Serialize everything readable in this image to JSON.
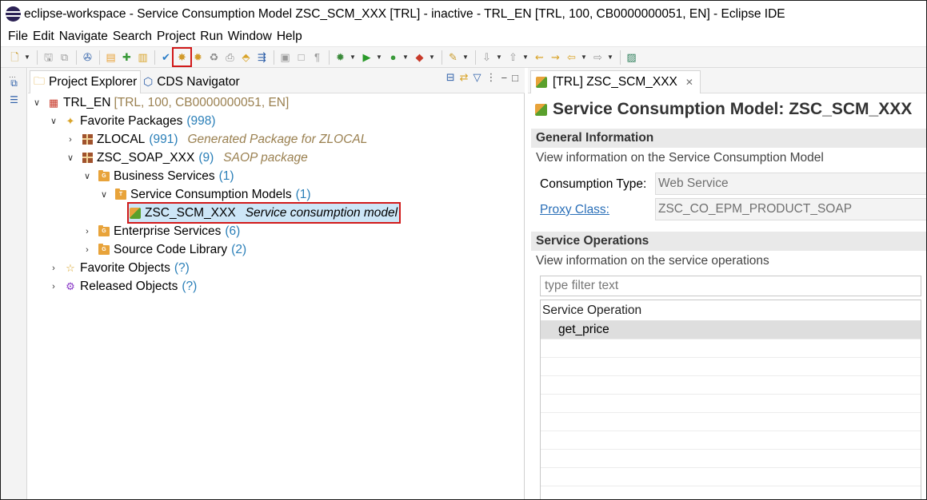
{
  "window": {
    "title": "eclipse-workspace - Service Consumption Model ZSC_SCM_XXX [TRL]  - inactive - TRL_EN [TRL, 100, CB0000000051, EN] - Eclipse IDE"
  },
  "menu": [
    "File",
    "Edit",
    "Navigate",
    "Search",
    "Project",
    "Run",
    "Window",
    "Help"
  ],
  "explorer": {
    "tabs": [
      {
        "label": "Project Explorer",
        "icon": "project-explorer-icon"
      },
      {
        "label": "CDS Navigator",
        "icon": "cds-navigator-icon"
      }
    ],
    "tree": {
      "project": {
        "label": "TRL_EN",
        "detail": "[TRL, 100, CB0000000051, EN]"
      },
      "favorite_packages": {
        "label": "Favorite Packages",
        "count": "(998)"
      },
      "zlocal": {
        "label": "ZLOCAL",
        "count": "(991)",
        "desc": "Generated Package for ZLOCAL"
      },
      "zsc_soap": {
        "label": "ZSC_SOAP_XXX",
        "count": "(9)",
        "desc": "SAOP package"
      },
      "business_services": {
        "label": "Business Services",
        "count": "(1)"
      },
      "scm_folder": {
        "label": "Service Consumption Models",
        "count": "(1)"
      },
      "scm_item": {
        "label": "ZSC_SCM_XXX",
        "desc": "Service consumption model"
      },
      "enterprise_services": {
        "label": "Enterprise Services",
        "count": "(6)"
      },
      "source_code_library": {
        "label": "Source Code Library",
        "count": "(2)"
      },
      "favorite_objects": {
        "label": "Favorite Objects",
        "count": "(?)"
      },
      "released_objects": {
        "label": "Released Objects",
        "count": "(?)"
      }
    }
  },
  "editor": {
    "tab_label": "[TRL] ZSC_SCM_XXX",
    "title": "Service Consumption Model: ZSC_SCM_XXX",
    "general": {
      "heading": "General Information",
      "description": "View information on the Service Consumption Model",
      "consumption_type_label": "Consumption Type:",
      "consumption_type_value": "Web Service",
      "proxy_class_label": "Proxy Class:",
      "proxy_class_value": "ZSC_CO_EPM_PRODUCT_SOAP"
    },
    "operations": {
      "heading": "Service Operations",
      "description": "View information on the service operations",
      "filter_placeholder": "type filter text",
      "column_header": "Service Operation",
      "rows": [
        "get_price"
      ]
    }
  }
}
